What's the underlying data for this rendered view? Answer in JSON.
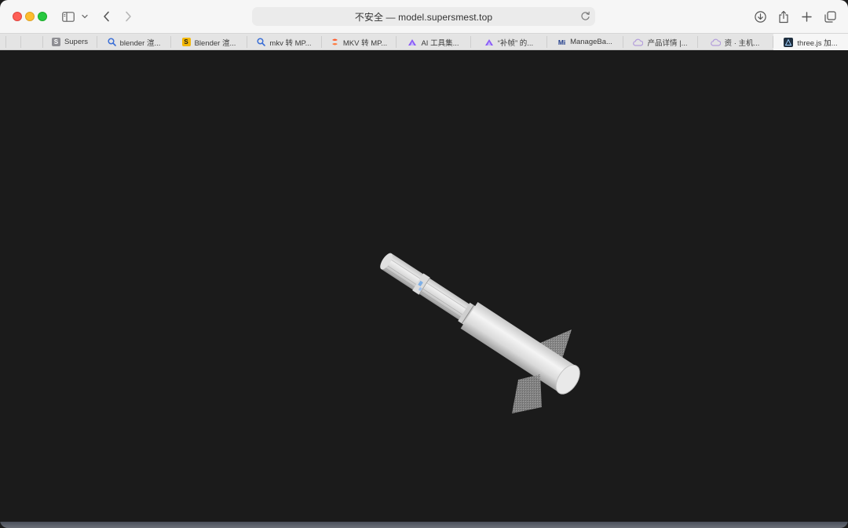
{
  "browser": {
    "address_bar": {
      "url_text": "不安全 — model.supersmest.top"
    },
    "tabs": [
      {
        "label": "Supers",
        "favicon": "s-letter-icon",
        "favicon_text": "S",
        "favicon_color": "#8e8e93"
      },
      {
        "label": "blender 渲...",
        "favicon": "search-icon",
        "favicon_color": "#3b6fd6"
      },
      {
        "label": "Blender 渲...",
        "favicon": "s-letter-icon",
        "favicon_text": "S",
        "favicon_color": "#f2b705"
      },
      {
        "label": "mkv 转 MP...",
        "favicon": "search-icon",
        "favicon_color": "#3b6fd6"
      },
      {
        "label": "MKV 转 MP...",
        "favicon": "swirl-icon",
        "favicon_color": "#ff5a2c"
      },
      {
        "label": "AI 工具集...",
        "favicon": "triangle-logo-icon",
        "favicon_color": "#8b5cf6"
      },
      {
        "label": "“补帧” 的...",
        "favicon": "triangle-logo-icon",
        "favicon_color": "#8b5cf6"
      },
      {
        "label": "ManageBa...",
        "favicon": "mb-logo-icon",
        "favicon_text": "Mi",
        "favicon_color": "#1e3a8a"
      },
      {
        "label": "产品详情 |...",
        "favicon": "cloud-icon",
        "favicon_color": "#b39ddb"
      },
      {
        "label": "资 · 主机...",
        "favicon": "cloud-icon",
        "favicon_color": "#b39ddb"
      },
      {
        "label": "three.js 加...",
        "favicon": "threejs-icon",
        "favicon_color": "#1f2f3f",
        "active": true
      }
    ]
  },
  "scene": {
    "background_color": "#1b1b1b",
    "model_color": "#e6e6e6",
    "fin_color": "#8a8a8a"
  }
}
